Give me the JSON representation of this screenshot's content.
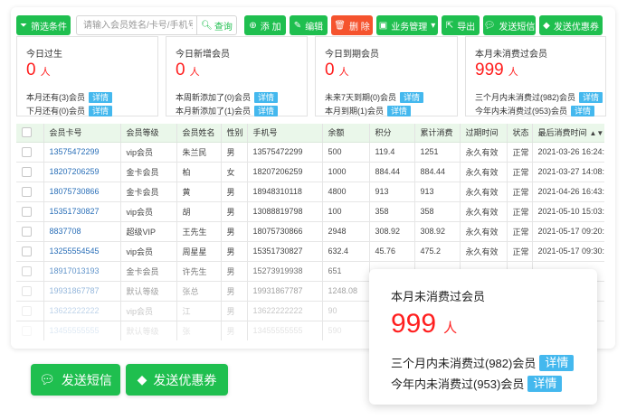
{
  "toolbar": {
    "filter_label": "筛选条件",
    "search_placeholder": "请输入会员姓名/卡号/手机号",
    "search_button": "查询",
    "add_label": "添 加",
    "edit_label": "编辑",
    "delete_label": "删 除",
    "business_label": "业务管理",
    "export_label": "导出",
    "sms_label": "发送短信",
    "coupon_label": "发送优惠券"
  },
  "stats": [
    {
      "title": "今日过生",
      "value": "0",
      "unit": "人",
      "line1": "本月还有(3)会员",
      "line2": "下月还有(0)会员",
      "badge": "详情"
    },
    {
      "title": "今日新增会员",
      "value": "0",
      "unit": "人",
      "line1": "本周新添加了(0)会员",
      "line2": "本月新添加了(1)会员",
      "badge": "详情"
    },
    {
      "title": "今日到期会员",
      "value": "0",
      "unit": "人",
      "line1": "未来7天到期(0)会员",
      "line2": "本月到期(1)会员",
      "badge": "详情"
    },
    {
      "title": "本月未消费过会员",
      "value": "999",
      "unit": "人",
      "line1": "三个月内未消费过(982)会员",
      "line2": "今年内未消费过(953)会员",
      "badge": "详情"
    }
  ],
  "table": {
    "headers": [
      "会员卡号",
      "会员等级",
      "会员姓名",
      "性别",
      "手机号",
      "余额",
      "积分",
      "累计消费",
      "过期时间",
      "状态",
      "最后消费时间"
    ],
    "rows": [
      [
        "13575472299",
        "vip会员",
        "朱兰民",
        "男",
        "13575472299",
        "500",
        "119.4",
        "1251",
        "永久有效",
        "正常",
        "2021-03-26 16:24:00"
      ],
      [
        "18207206259",
        "金卡会员",
        "柏",
        "女",
        "18207206259",
        "1000",
        "884.44",
        "884.44",
        "永久有效",
        "正常",
        "2021-03-27 14:08:14"
      ],
      [
        "18075730866",
        "金卡会员",
        "黄",
        "男",
        "18948310118",
        "4800",
        "913",
        "913",
        "永久有效",
        "正常",
        "2021-04-26 16:43:41"
      ],
      [
        "15351730827",
        "vip会员",
        "胡",
        "男",
        "13088819798",
        "100",
        "358",
        "358",
        "永久有效",
        "正常",
        "2021-05-10 15:03:40"
      ],
      [
        "8837708",
        "超级VIP",
        "王先生",
        "男",
        "18075730866",
        "2948",
        "308.92",
        "308.92",
        "永久有效",
        "正常",
        "2021-05-17 09:20:43"
      ],
      [
        "13255554545",
        "vip会员",
        "周星星",
        "男",
        "15351730827",
        "632.4",
        "45.76",
        "475.2",
        "永久有效",
        "正常",
        "2021-05-17 09:30:24"
      ],
      [
        "18917013193",
        "金卡会员",
        "许先生",
        "男",
        "15273919938",
        "651",
        "",
        "",
        "",
        "",
        ""
      ],
      [
        "19931867787",
        "默认等级",
        "张总",
        "男",
        "19931867787",
        "1248.08",
        "",
        "",
        "",
        "",
        ""
      ],
      [
        "13622222222",
        "vip会员",
        "江",
        "男",
        "13622222222",
        "90",
        "",
        "",
        "",
        "",
        ""
      ],
      [
        "13455555555",
        "默认等级",
        "张",
        "男",
        "13455555555",
        "590",
        "",
        "",
        "",
        "",
        ""
      ]
    ]
  },
  "popup": {
    "title": "本月未消费过会员",
    "value": "999",
    "unit": "人",
    "line1": "三个月内未消费过(982)会员",
    "line2": "今年内未消费过(953)会员",
    "badge": "详情"
  },
  "bottom": {
    "sms_label": "发送短信",
    "coupon_label": "发送优惠券"
  },
  "colors": {
    "primary_green": "#1fbf4f",
    "danger_red": "#f5532e",
    "badge_blue": "#44b8ee",
    "number_red": "#ff1f1f",
    "header_bg": "#eaf7ea"
  }
}
